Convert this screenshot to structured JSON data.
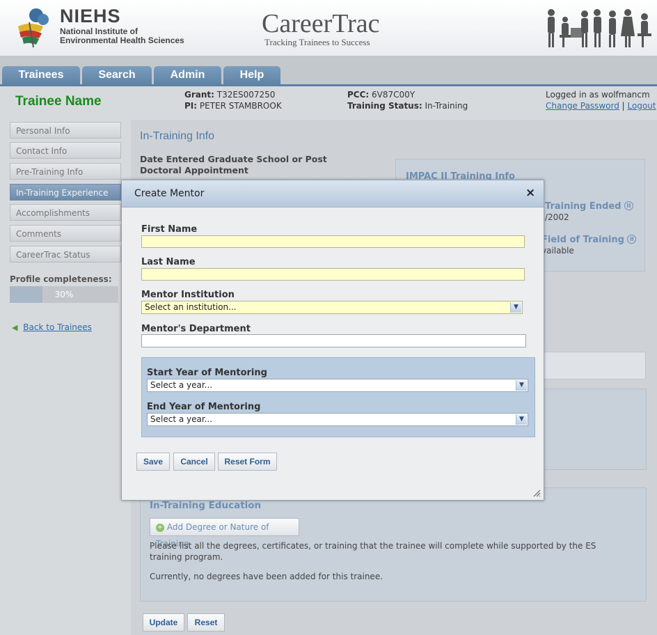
{
  "header": {
    "org_short": "NIEHS",
    "org_line1": "National Institute of",
    "org_line2": "Environmental Health Sciences",
    "app_title": "CareerTrac",
    "app_tagline": "Tracking Trainees to Success"
  },
  "nav": {
    "tabs": [
      {
        "label": "Trainees"
      },
      {
        "label": "Search"
      },
      {
        "label": "Admin"
      },
      {
        "label": "Help"
      }
    ]
  },
  "info": {
    "trainee_name": "Trainee Name",
    "grant_label": "Grant:",
    "grant_value": "T32ES007250",
    "pi_label": "PI:",
    "pi_value": "PETER STAMBROOK",
    "pcc_label": "PCC:",
    "pcc_value": "6V87C00Y",
    "status_label": "Training Status:",
    "status_value": "In-Training",
    "logged_in": "Logged in as wolfmancm",
    "change_password": "Change Password",
    "separator": "|",
    "logout": "Logout"
  },
  "sidebar": {
    "items": [
      {
        "label": "Personal Info"
      },
      {
        "label": "Contact Info"
      },
      {
        "label": "Pre-Training Info"
      },
      {
        "label": "In-Training Experience"
      },
      {
        "label": "Accomplishments"
      },
      {
        "label": "Comments"
      },
      {
        "label": "CareerTrac Status"
      }
    ],
    "profile_label": "Profile completeness:",
    "profile_percent": 30,
    "profile_text": "30%",
    "back_link": "Back to Trainees"
  },
  "main": {
    "section_title": "In-Training Info",
    "date_entered_label": "Date Entered Graduate School or Post Doctoral Appointment",
    "impac_title": "IMPAC II Training Info",
    "impac_training_ended_label": "Training Ended",
    "impac_training_ended_value": "/2002",
    "impac_field_label": "Field of Training",
    "impac_field_value": "vailable",
    "education_title": "In-Training Education",
    "add_degree_button": "Add Degree or Nature of Training",
    "education_help": "Please list all the degrees, certificates, or training that the trainee will complete while supported by the ES training program.",
    "education_empty": "Currently, no degrees have been added for this trainee.",
    "update_button": "Update",
    "reset_button": "Reset"
  },
  "modal": {
    "title": "Create Mentor",
    "close_glyph": "×",
    "first_name_label": "First Name",
    "first_name_value": "",
    "last_name_label": "Last Name",
    "last_name_value": "",
    "institution_label": "Mentor Institution",
    "institution_selected": "Select an institution...",
    "department_label": "Mentor's Department",
    "department_value": "",
    "start_year_label": "Start Year of Mentoring",
    "start_year_selected": "Select a year...",
    "end_year_label": "End Year of Mentoring",
    "end_year_selected": "Select a year...",
    "save_button": "Save",
    "cancel_button": "Cancel",
    "reset_form_button": "Reset Form"
  },
  "colors": {
    "accent_green": "#1a8a1a",
    "tab_blue": "#6a8fb3",
    "link_blue": "#2d6aa6",
    "required_yellow": "#ffffcc"
  }
}
